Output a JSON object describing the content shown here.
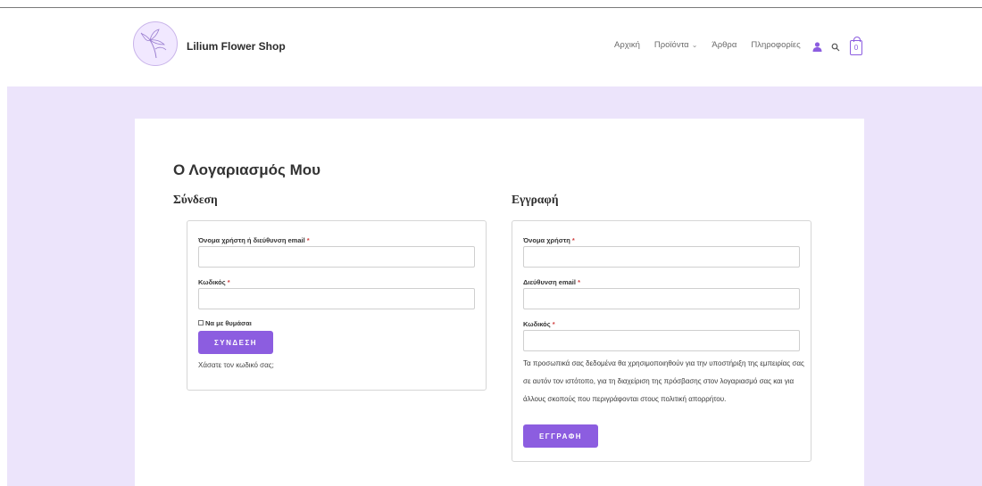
{
  "header": {
    "brand": "Lilium Flower Shop",
    "nav": [
      {
        "label": "Αρχική"
      },
      {
        "label": "Προϊόντα",
        "has_dropdown": true
      },
      {
        "label": "Άρθρα"
      },
      {
        "label": "Πληροφορίες"
      }
    ],
    "cart_count": "0"
  },
  "page": {
    "title": "Ο Λογαριασμός Μου"
  },
  "login": {
    "title": "Σύνδεση",
    "username_label": "Όνομα χρήστη ή διεύθυνση email",
    "password_label": "Κωδικός",
    "remember_label": "Να με θυμάσαι",
    "button": "ΣΥΝΔΕΣΗ",
    "lost_password": "Χάσατε τον κωδικό σας;"
  },
  "register": {
    "title": "Εγγραφή",
    "username_label": "Όνομα χρήστη",
    "email_label": "Διεύθυνση email",
    "password_label": "Κωδικός",
    "privacy_text": "Τα προσωπικά σας δεδομένα θα χρησιμοποιηθούν για την υποστήριξη της εμπειρίας σας σε αυτόν τον ιστότοπο, για τη διαχείριση της πρόσβασης στον λογαριασμό σας και για άλλους σκοπούς που περιγράφονται στους πολιτική απορρήτου.",
    "button": "ΕΓΓΡΑΦΗ"
  },
  "required_marker": "*",
  "colors": {
    "accent": "#8c5de0",
    "page_background": "#ece4fb"
  }
}
